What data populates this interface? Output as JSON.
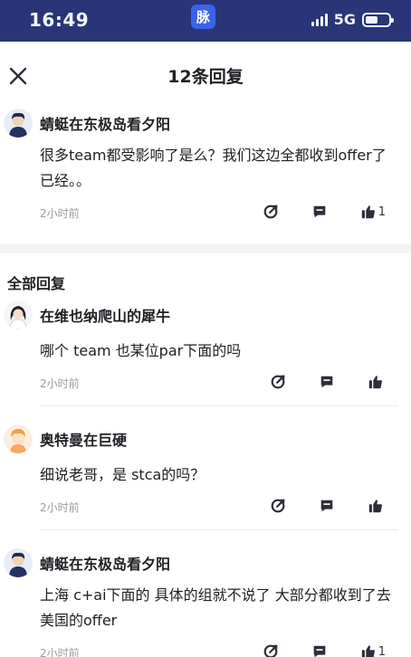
{
  "status_bar": {
    "time": "16:49",
    "app_icon_char": "脉",
    "network": "5G",
    "battery_level": 0.55
  },
  "header": {
    "title": "12条回复"
  },
  "top_comment": {
    "user": "蜻蜓在东极岛看夕阳",
    "text": "很多team都受影响了是么？我们这边全都收到offer了已经。。",
    "time": "2小时前",
    "likes": "1"
  },
  "section": {
    "title": "全部回复"
  },
  "replies": [
    {
      "user": "在维也纳爬山的犀牛",
      "text": "哪个 team 也某位par下面的吗",
      "time": "2小时前",
      "likes": ""
    },
    {
      "user": "奥特曼在巨硬",
      "text": "细说老哥，是 stca的吗？",
      "time": "2小时前",
      "likes": ""
    },
    {
      "user": "蜻蜓在东极岛看夕阳",
      "text": "上海 c+ai下面的 具体的组就不说了 大部分都收到了去美国的offer",
      "time": "2小时前",
      "likes": "1"
    }
  ],
  "colors": {
    "status_bg": "#2a3577",
    "icon": "#2e2e3a",
    "timestamp": "#9a9ba3"
  },
  "icons": [
    "close-icon",
    "share-icon",
    "comment-icon",
    "like-icon"
  ]
}
